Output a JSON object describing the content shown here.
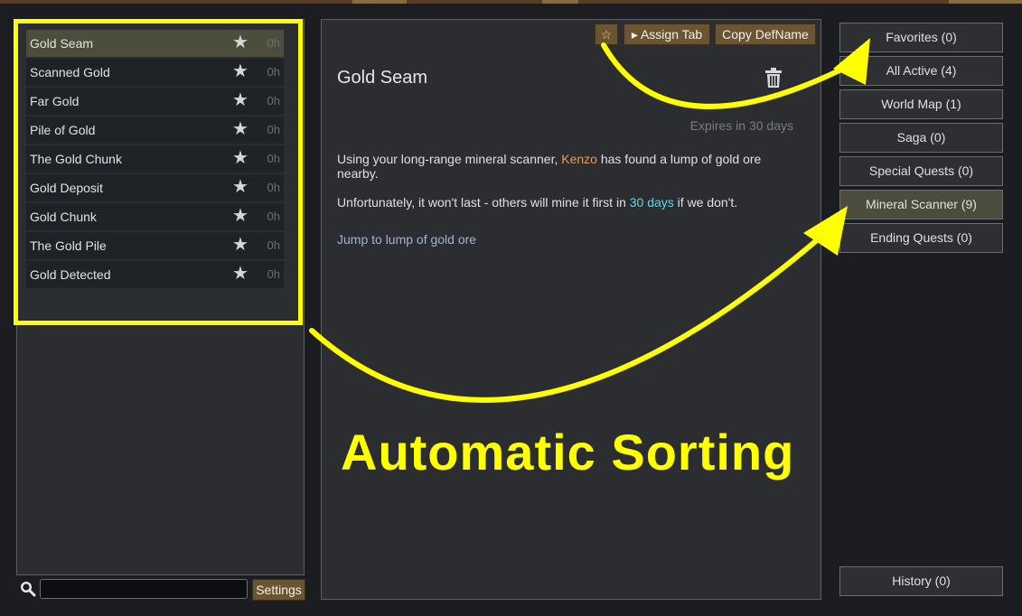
{
  "quest_list": {
    "items": [
      {
        "name": "Gold Seam",
        "time": "0h"
      },
      {
        "name": "Scanned Gold",
        "time": "0h"
      },
      {
        "name": "Far Gold",
        "time": "0h"
      },
      {
        "name": "Pile of Gold",
        "time": "0h"
      },
      {
        "name": "The Gold Chunk",
        "time": "0h"
      },
      {
        "name": "Gold Deposit",
        "time": "0h"
      },
      {
        "name": "Gold Chunk",
        "time": "0h"
      },
      {
        "name": "The Gold Pile",
        "time": "0h"
      },
      {
        "name": "Gold Detected",
        "time": "0h"
      }
    ],
    "star_glyph": "★"
  },
  "search": {
    "value": "",
    "placeholder": ""
  },
  "settings_label": "Settings",
  "detail": {
    "fav_glyph": "☆",
    "assign_label": "▸ Assign Tab",
    "copy_label": "Copy DefName",
    "title": "Gold Seam",
    "expires": "Expires in 30 days",
    "p1_before": "Using your long-range mineral scanner, ",
    "pawn": "Kenzo",
    "p1_after": " has found a lump of gold ore nearby.",
    "p2_before": "Unfortunately, it won't last - others will mine it first in ",
    "days": "30 days",
    "p2_after": " if we don't.",
    "jump": "Jump to lump of gold ore"
  },
  "tabs": [
    "Favorites (0)",
    "All Active (4)",
    "World Map (1)",
    "Saga (0)",
    "Special Quests (0)",
    "Mineral Scanner (9)",
    "Ending Quests (0)"
  ],
  "history_label": "History (0)",
  "caption": "Automatic Sorting",
  "colors": {
    "annotation": "#ffff00",
    "button_brown": "#6b5531",
    "pawn_name": "#e89a5c",
    "days_highlight": "#6ecfe6",
    "selected_row": "#4d4d3c"
  }
}
